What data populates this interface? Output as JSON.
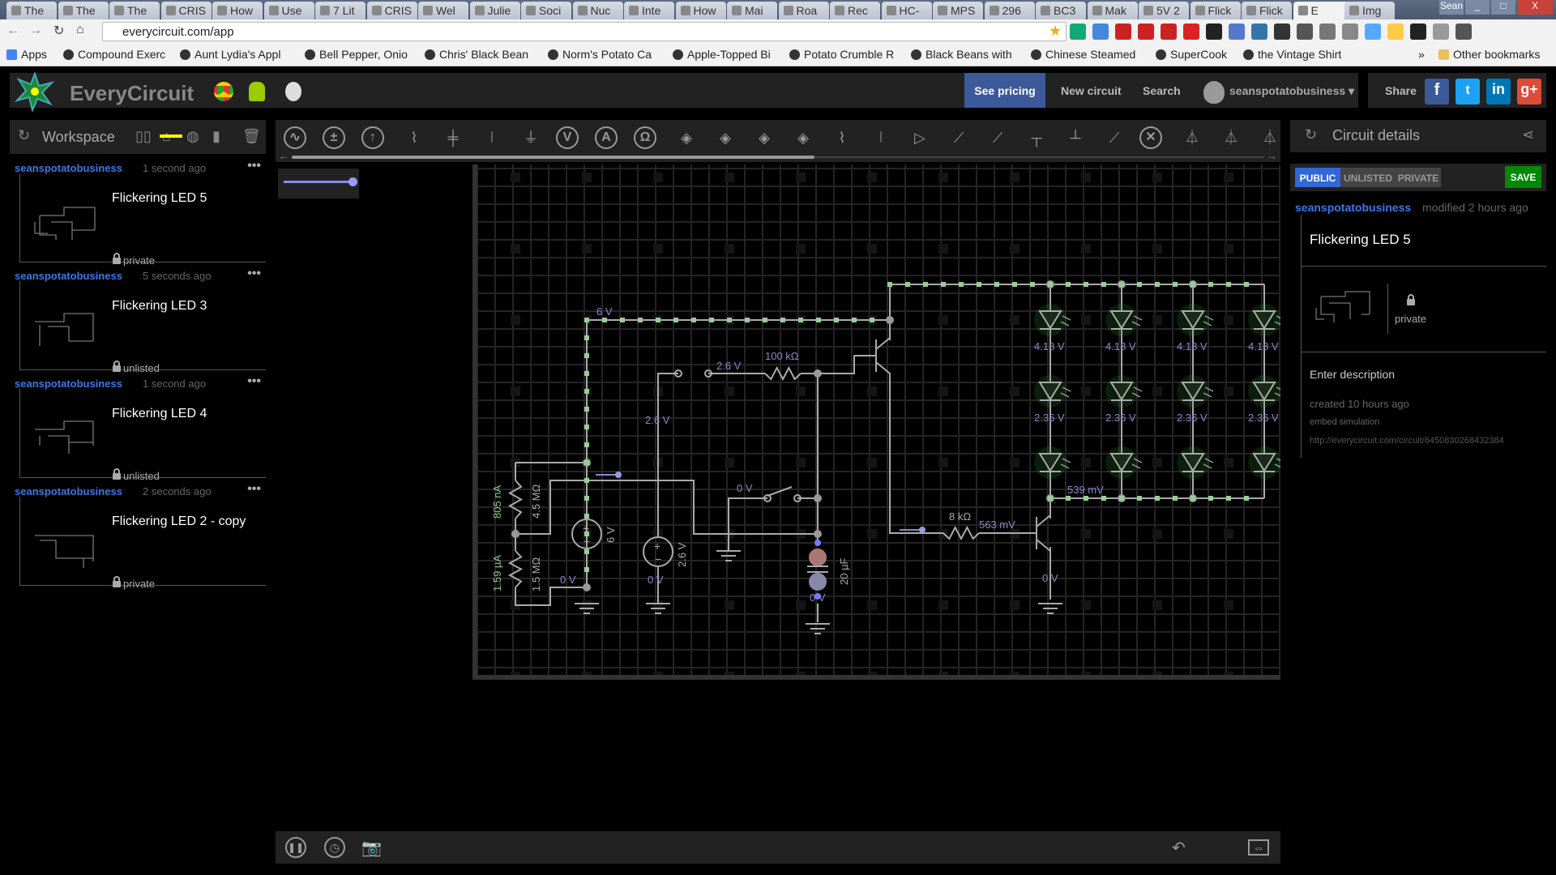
{
  "browser": {
    "tabs": [
      "The",
      "The",
      "The",
      "CRIS",
      "How",
      "Use",
      "7 Lit",
      "CRIS",
      "Wel",
      "Julie",
      "Soci",
      "Nuc",
      "Inte",
      "How",
      "Mai",
      "Roa",
      "Rec",
      "HC-",
      "MPS",
      "296",
      "BC3",
      "Mak",
      "5V 2",
      "Flick",
      "Flick",
      "E",
      "Img"
    ],
    "active_tab_index": 25,
    "profile": "Sean",
    "url": "everycircuit.com/app",
    "bookmarks": [
      "Apps",
      "Compound Exerc",
      "Aunt Lydia's Appl",
      "Bell Pepper, Onio",
      "Chris' Black Bean",
      "Norm's Potato Ca",
      "Apple-Topped Bi",
      "Potato Crumble R",
      "Black Beans with",
      "Chinese Steamed",
      "SuperCook",
      "the Vintage Shirt"
    ],
    "overflow": "»",
    "other_bookmarks": "Other bookmarks"
  },
  "header": {
    "brand": "EveryCircuit",
    "see_pricing": "See pricing",
    "new_circuit": "New circuit",
    "search": "Search",
    "user": "seanspotatobusiness",
    "share": "Share",
    "accent": "#3c5a99"
  },
  "workspace": {
    "title": "Workspace",
    "items": [
      {
        "user": "seanspotatobusiness",
        "time": "1 second ago",
        "title": "Flickering LED 5",
        "visibility": "private"
      },
      {
        "user": "seanspotatobusiness",
        "time": "5 seconds ago",
        "title": "Flickering LED 3",
        "visibility": "unlisted"
      },
      {
        "user": "seanspotatobusiness",
        "time": "1 second ago",
        "title": "Flickering LED 4",
        "visibility": "unlisted"
      },
      {
        "user": "seanspotatobusiness",
        "time": "2 seconds ago",
        "title": "Flickering LED 2 - copy",
        "visibility": "private"
      }
    ]
  },
  "toolbar": {
    "tools": [
      "ac-source",
      "dc-voltage-source",
      "current-source",
      "resistor",
      "capacitor",
      "inductor",
      "ground",
      "voltmeter",
      "ammeter",
      "ohmmeter",
      "vcvs",
      "vccs",
      "ccvs",
      "cccs",
      "potentiometer",
      "transformer",
      "op-amp",
      "switch-spdt",
      "switch",
      "push-button-no",
      "push-button-nc",
      "relay",
      "lamp",
      "led",
      "diode",
      "zener"
    ]
  },
  "circuit": {
    "labels": [
      "6 V",
      "2.6 V",
      "100 kΩ",
      "2.6 V",
      "0 V",
      "805 nA",
      "4.5 MΩ",
      "1.59 µA",
      "1.5 MΩ",
      "6 V",
      "2.6 V",
      "0 V",
      "0 V",
      "20 µF",
      "0 V",
      "4.18 V",
      "4.18 V",
      "4.18 V",
      "4.18 V",
      "2.36 V",
      "2.36 V",
      "2.36 V",
      "2.36 V",
      "539 mV",
      "8 kΩ",
      "563 mV",
      "0 V"
    ]
  },
  "details": {
    "title": "Circuit details",
    "visibility_options": [
      "PUBLIC",
      "UNLISTED",
      "PRIVATE"
    ],
    "selected_visibility": "PUBLIC",
    "save": "SAVE",
    "user": "seanspotatobusiness",
    "modified": "modified 2 hours ago",
    "circuit_title": "Flickering LED 5",
    "visibility": "private",
    "description_placeholder": "Enter description",
    "created": "created 10 hours ago",
    "embed": "embed simulation",
    "link": "http://everycircuit.com/circuit/6450830268432384"
  }
}
